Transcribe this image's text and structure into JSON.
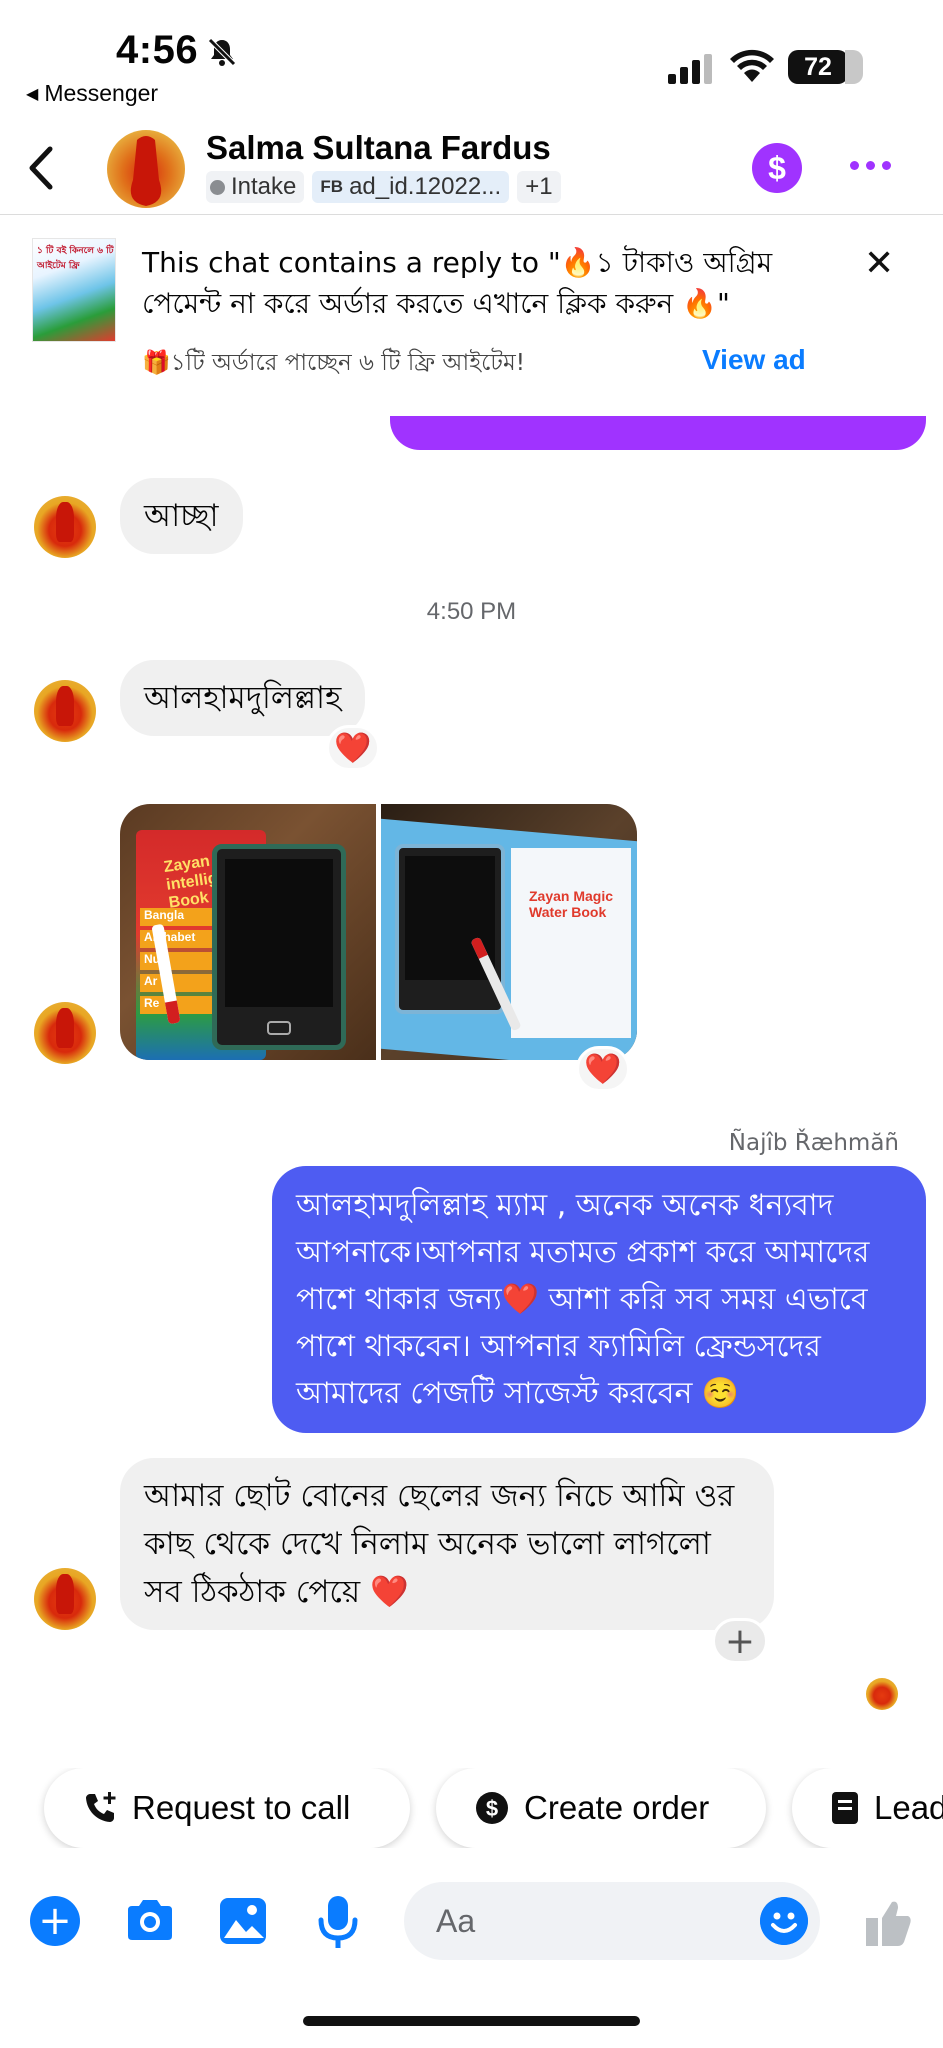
{
  "status_bar": {
    "time": "4:56",
    "back_app": "Messenger",
    "battery": "72"
  },
  "header": {
    "contact_name": "Salma Sultana Fardus",
    "tag_intake": "Intake",
    "tag_ad_prefix": "FB",
    "tag_ad": "ad_id.12022...",
    "tag_more": "+1",
    "accent_color": "#a033ff"
  },
  "ad_banner": {
    "text": "This chat contains a reply to \"🔥১ টাকাও অগ্রিম পেমেন্ট না করে অর্ডার করতে এখানে ক্লিক করুন 🔥\"",
    "gift_text": "🎁১টি অর্ডারে পাচ্ছেন ৬ টি ফ্রি আইটেম!",
    "view_ad": "View ad",
    "thumb_text": "১ টি বই কিনলে ৬ টি আইটেম ফ্রি"
  },
  "messages": {
    "acha": "আচ্ছা",
    "timestamp": "4:50 PM",
    "alhamdulillah": "আলহামদুলিল্লাহ",
    "reaction_heart": "❤️",
    "photo1_title": "Zayan intelligence Book",
    "photo1_rows": [
      "Bangla",
      "Alphabet",
      "Nu",
      "Ar",
      "Re"
    ],
    "photo2_title": "Zayan Magic Water Book",
    "sender_name": "Ñajîb Řæhmăñ",
    "outgoing": "আলহামদুলিল্লাহ ম্যাম , অনেক অনেক ধন্যবাদ আপনাকে।আপনার মতামত প্রকাশ করে আমাদের পাশে থাকার জন্য❤️  আশা করি সব সময় এভাবে পাশে থাকবেন। আপনার ফ্যামিলি ফ্রেন্ডসদের আমাদের পেজটি সাজেস্ট করবেন ☺️",
    "incoming_last": "আমার ছোট বোনের ছেলের জন্য নিচে আমি ওর কাছ থেকে দেখে নিলাম অনেক ভালো লাগলো সব ঠিকঠাক পেয়ে ❤️",
    "add_reaction": "+"
  },
  "quick_replies": {
    "call": "Request to call",
    "order": "Create order",
    "lead": "Lead"
  },
  "composer": {
    "placeholder": "Aa",
    "accent_color": "#0a7cff"
  }
}
